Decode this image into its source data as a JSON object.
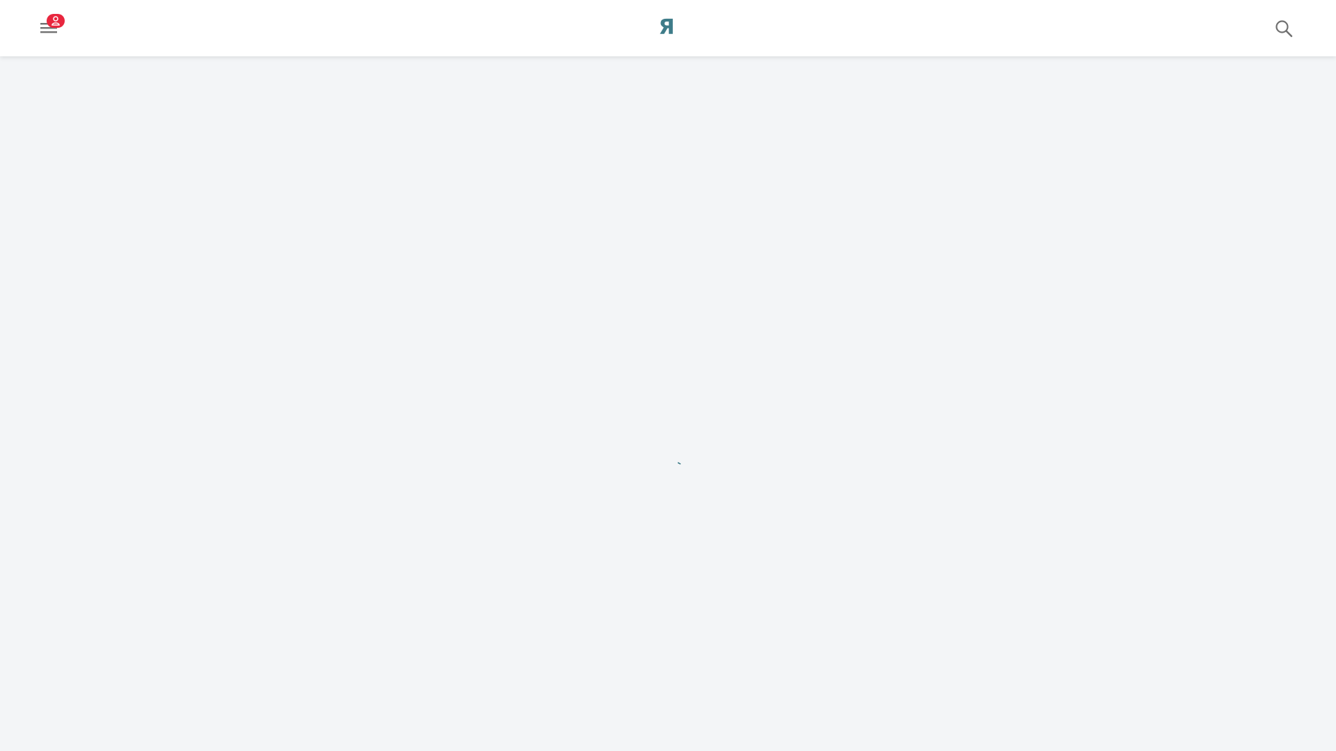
{
  "header": {
    "logo_text": "Я",
    "menu_icon": "hamburger-icon",
    "badge_icon": "user-icon",
    "search_icon": "search-icon"
  },
  "colors": {
    "accent": "#3e7c89",
    "badge": "#e8263e",
    "background": "#f3f5f7",
    "header_bg": "#ffffff",
    "icon": "#707070"
  },
  "main": {
    "loading_icon": "spinner-icon"
  }
}
